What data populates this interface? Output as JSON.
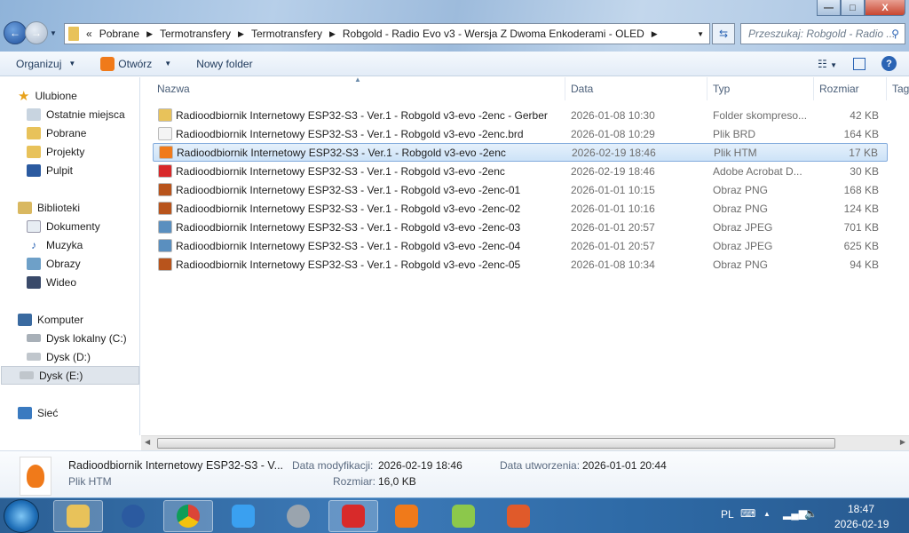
{
  "window": {
    "minimize": "—",
    "maximize": "□",
    "close": "X"
  },
  "address": {
    "overflow": "«",
    "crumbs": [
      "Pobrane",
      "Termotransfery",
      "Termotransfery",
      "Robgold - Radio Evo v3 - Wersja Z Dwoma Enkoderami - OLED"
    ],
    "search_placeholder": "Przeszukaj: Robgold - Radio ..."
  },
  "toolbar": {
    "organize": "Organizuj",
    "open": "Otwórz",
    "new_folder": "Nowy folder"
  },
  "nav": {
    "favorites": {
      "label": "Ulubione",
      "items": [
        "Ostatnie miejsca",
        "Pobrane",
        "Projekty",
        "Pulpit"
      ]
    },
    "libraries": {
      "label": "Biblioteki",
      "items": [
        "Dokumenty",
        "Muzyka",
        "Obrazy",
        "Wideo"
      ]
    },
    "computer": {
      "label": "Komputer",
      "items": [
        "Dysk lokalny (C:)",
        "Dysk (D:)",
        "Dysk (E:)"
      ]
    },
    "network": {
      "label": "Sieć"
    }
  },
  "columns": {
    "name": "Nazwa",
    "date": "Data",
    "type": "Typ",
    "size": "Rozmiar",
    "tags": "Tag"
  },
  "files": [
    {
      "name": "Radioodbiornik Internetowy ESP32-S3 - Ver.1 - Robgold v3-evo -2enc - Gerber",
      "date": "2026-01-08 10:30",
      "type": "Folder skompreso...",
      "size": "42 KB",
      "icon": "zip-folder-icon",
      "color": "#e8c25a"
    },
    {
      "name": "Radioodbiornik Internetowy ESP32-S3 - Ver.1 - Robgold v3-evo -2enc.brd",
      "date": "2026-01-08 10:29",
      "type": "Plik BRD",
      "size": "164 KB",
      "icon": "file-icon",
      "color": "#f4f4f4"
    },
    {
      "name": "Radioodbiornik Internetowy ESP32-S3 - Ver.1 - Robgold v3-evo -2enc",
      "date": "2026-02-19 18:46",
      "type": "Plik HTM",
      "size": "17 KB",
      "icon": "html-file-icon",
      "color": "#f07a1a",
      "selected": true
    },
    {
      "name": "Radioodbiornik Internetowy ESP32-S3 - Ver.1 - Robgold v3-evo -2enc",
      "date": "2026-02-19 18:46",
      "type": "Adobe Acrobat D...",
      "size": "30 KB",
      "icon": "pdf-file-icon",
      "color": "#d8282a"
    },
    {
      "name": "Radioodbiornik Internetowy ESP32-S3 - Ver.1 - Robgold v3-evo -2enc-01",
      "date": "2026-01-01 10:15",
      "type": "Obraz PNG",
      "size": "168 KB",
      "icon": "png-image-icon",
      "color": "#b8541c"
    },
    {
      "name": "Radioodbiornik Internetowy ESP32-S3 - Ver.1 - Robgold v3-evo -2enc-02",
      "date": "2026-01-01 10:16",
      "type": "Obraz PNG",
      "size": "124 KB",
      "icon": "png-image-icon",
      "color": "#b8541c"
    },
    {
      "name": "Radioodbiornik Internetowy ESP32-S3 - Ver.1 - Robgold v3-evo -2enc-03",
      "date": "2026-01-01 20:57",
      "type": "Obraz JPEG",
      "size": "701 KB",
      "icon": "jpeg-image-icon",
      "color": "#5a8fbf"
    },
    {
      "name": "Radioodbiornik Internetowy ESP32-S3 - Ver.1 - Robgold v3-evo -2enc-04",
      "date": "2026-01-01 20:57",
      "type": "Obraz JPEG",
      "size": "625 KB",
      "icon": "jpeg-image-icon",
      "color": "#5a8fbf"
    },
    {
      "name": "Radioodbiornik Internetowy ESP32-S3 - Ver.1 - Robgold v3-evo -2enc-05",
      "date": "2026-01-08 10:34",
      "type": "Obraz PNG",
      "size": "94 KB",
      "icon": "png-image-icon",
      "color": "#b8541c"
    }
  ],
  "details": {
    "name": "Radioodbiornik Internetowy ESP32-S3 - V...",
    "type": "Plik HTM",
    "modified_label": "Data modyfikacji:",
    "modified": "2026-02-19 18:46",
    "created_label": "Data utworzenia:",
    "created": "2026-01-01 20:44",
    "size_label": "Rozmiar:",
    "size": "16,0 KB"
  },
  "tray": {
    "lang": "PL",
    "time": "18:47",
    "date": "2026-02-19"
  }
}
